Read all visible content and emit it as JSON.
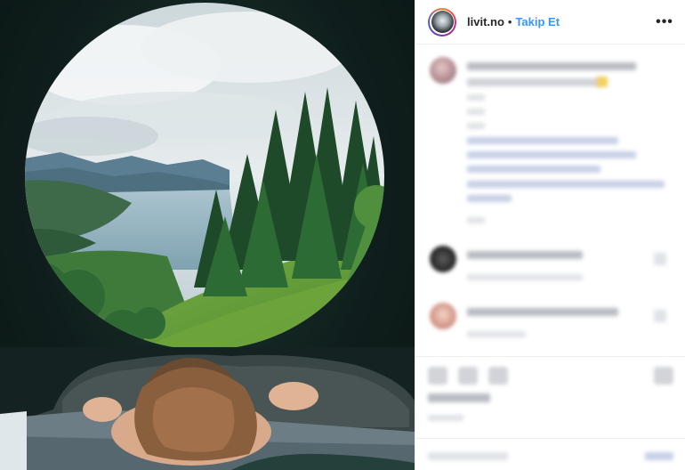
{
  "header": {
    "username": "livit.no",
    "separator": "•",
    "follow_label": "Takip Et",
    "more_label": "•••"
  },
  "icons": {
    "avatar": "profile-avatar",
    "more": "more-options-icon",
    "like": "heart-icon",
    "comment": "comment-icon",
    "share": "share-icon",
    "save": "bookmark-icon"
  },
  "colors": {
    "follow_accent": "#3897f0",
    "text": "#262626",
    "border": "#efefef"
  }
}
